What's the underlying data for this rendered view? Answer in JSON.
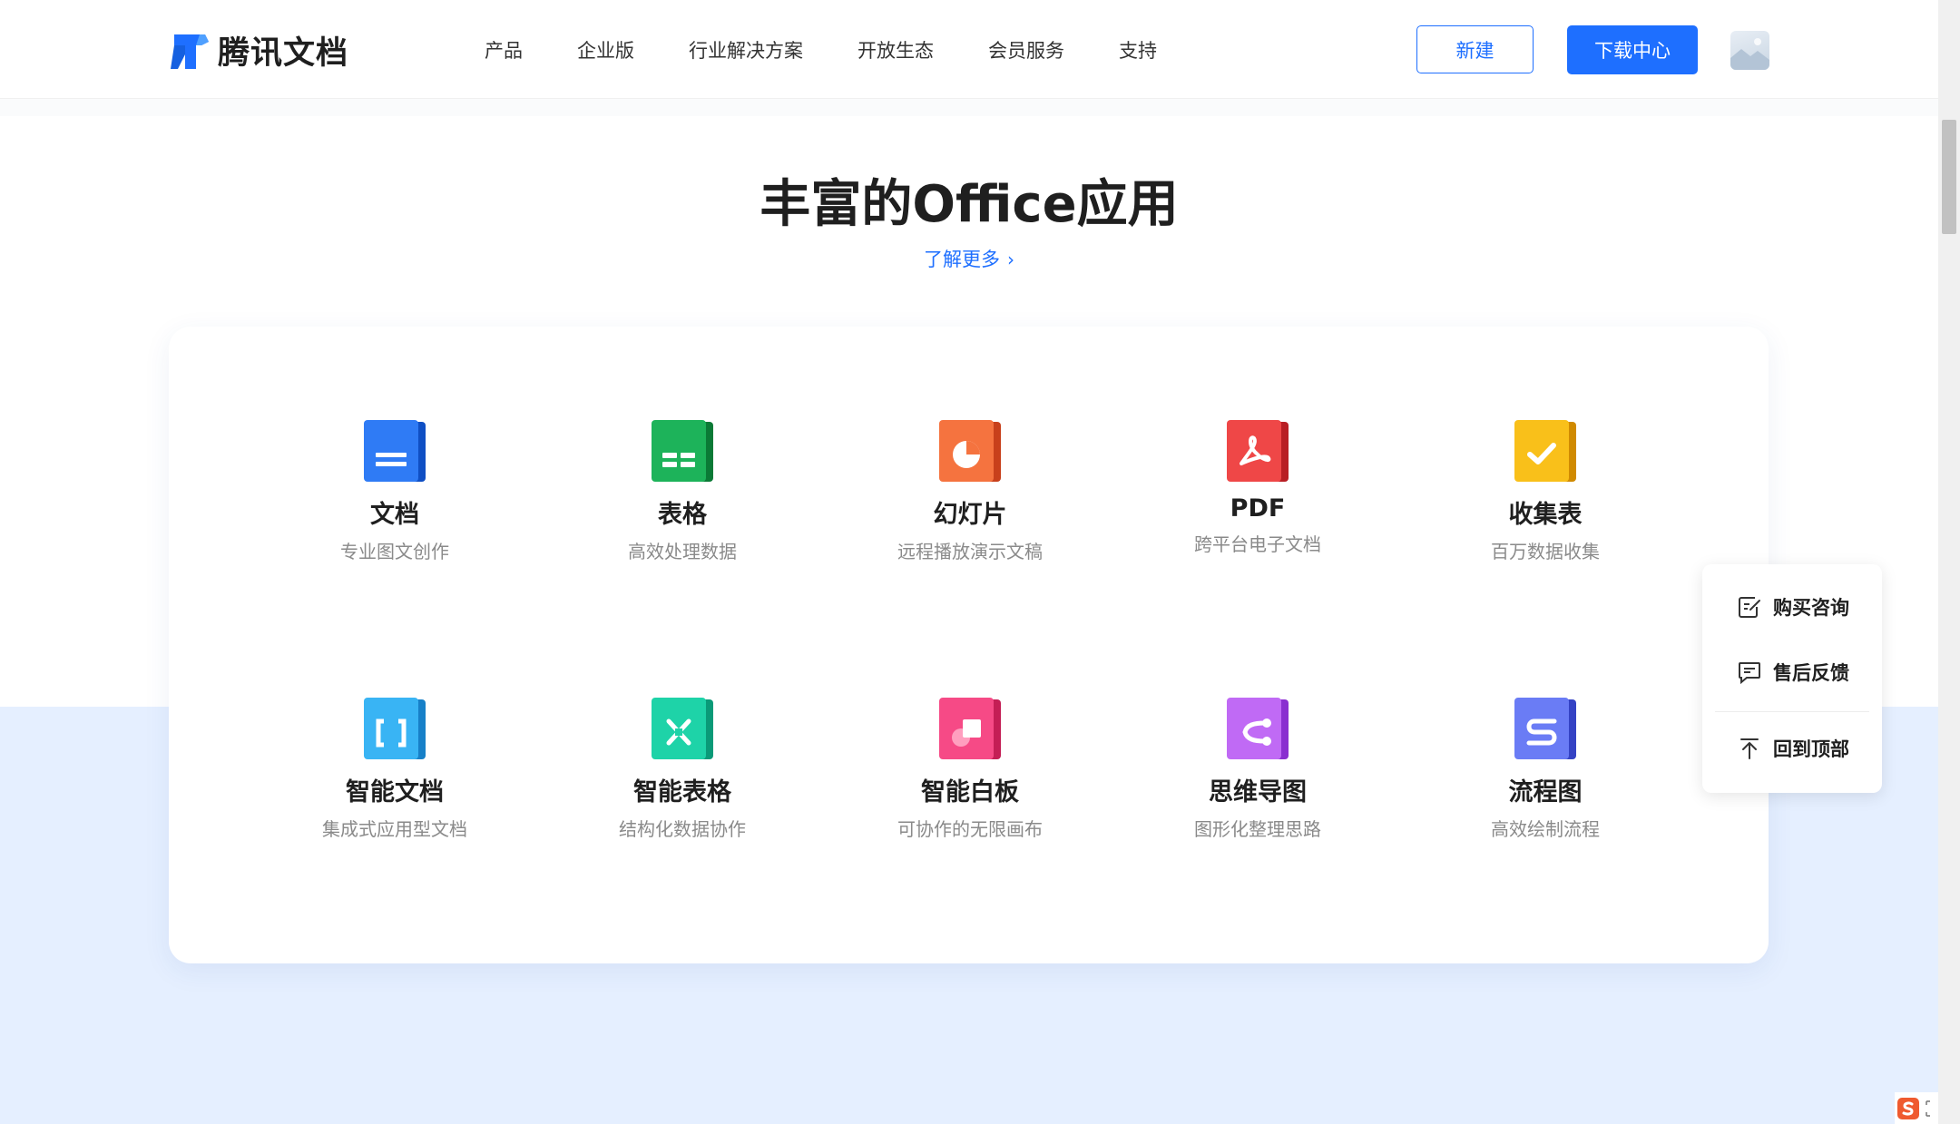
{
  "brand": {
    "name": "腾讯文档",
    "accent": "#1e6fff"
  },
  "nav": {
    "items": [
      "产品",
      "企业版",
      "行业解决方案",
      "开放生态",
      "会员服务",
      "支持"
    ],
    "new_label": "新建",
    "download_label": "下载中心"
  },
  "section": {
    "title": "丰富的Office应用",
    "learn_more": "了解更多"
  },
  "apps": [
    {
      "name": "文档",
      "desc": "专业图文创作",
      "icon": "doc-icon",
      "color": "#1e6fff"
    },
    {
      "name": "表格",
      "desc": "高效处理数据",
      "icon": "sheet-icon",
      "color": "#16a34a"
    },
    {
      "name": "幻灯片",
      "desc": "远程播放演示文稿",
      "icon": "slides-icon",
      "color": "#f26a3b"
    },
    {
      "name": "PDF",
      "desc": "跨平台电子文档",
      "icon": "pdf-icon",
      "color": "#e8373d"
    },
    {
      "name": "收集表",
      "desc": "百万数据收集",
      "icon": "form-icon",
      "color": "#f7b50f"
    },
    {
      "name": "智能文档",
      "desc": "集成式应用型文档",
      "icon": "smart-doc-icon",
      "color": "#2fa8f0"
    },
    {
      "name": "智能表格",
      "desc": "结构化数据协作",
      "icon": "smart-sheet-icon",
      "color": "#14c39a"
    },
    {
      "name": "智能白板",
      "desc": "可协作的无限画布",
      "icon": "whiteboard-icon",
      "color": "#f0407a"
    },
    {
      "name": "思维导图",
      "desc": "图形化整理思路",
      "icon": "mindmap-icon",
      "color": "#b35cf0"
    },
    {
      "name": "流程图",
      "desc": "高效绘制流程",
      "icon": "flowchart-icon",
      "color": "#5a6cf0"
    }
  ],
  "float_panel": {
    "consult": "购买咨询",
    "feedback": "售后反馈",
    "top": "回到顶部"
  }
}
